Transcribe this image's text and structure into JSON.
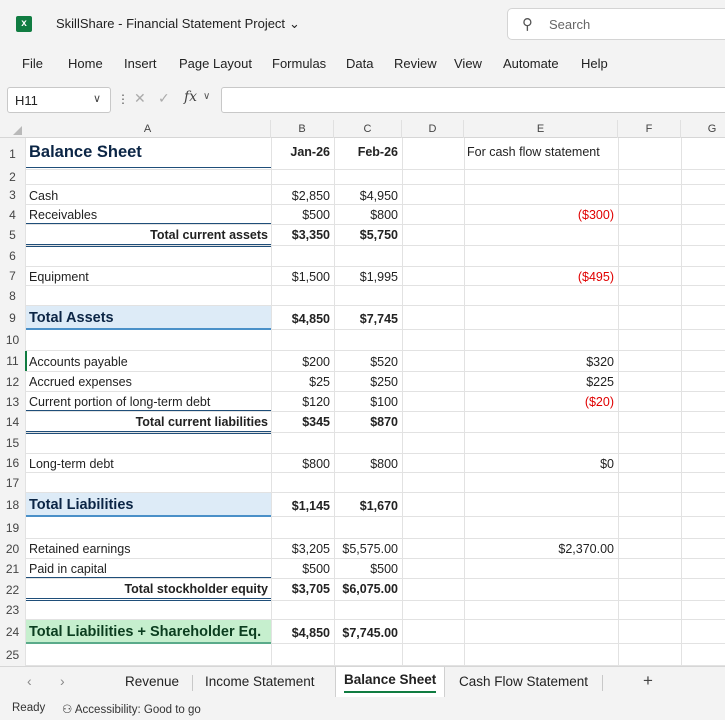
{
  "titlebar": {
    "doc_title": "SkillShare - Financial Statement Project",
    "search_placeholder": "Search"
  },
  "menu": [
    "File",
    "Home",
    "Insert",
    "Page Layout",
    "Formulas",
    "Data",
    "Review",
    "View",
    "Automate",
    "Help"
  ],
  "formula_bar": {
    "name_box": "H11",
    "fx_label": "fx",
    "formula": ""
  },
  "columns": [
    "A",
    "B",
    "C",
    "D",
    "E",
    "F",
    "G"
  ],
  "rows": {
    "r1": {
      "num": "1",
      "a": "Balance Sheet",
      "b": "Jan-26",
      "c": "Feb-26",
      "e": "For cash flow statement"
    },
    "r2": {
      "num": "2"
    },
    "r3": {
      "num": "3",
      "a": "Cash",
      "b": "$2,850",
      "c": "$4,950"
    },
    "r4": {
      "num": "4",
      "a": "Receivables",
      "b": "$500",
      "c": "$800",
      "e": "($300)"
    },
    "r5": {
      "num": "5",
      "a": "Total current assets",
      "b": "$3,350",
      "c": "$5,750"
    },
    "r6": {
      "num": "6"
    },
    "r7": {
      "num": "7",
      "a": "Equipment",
      "b": "$1,500",
      "c": "$1,995",
      "e": "($495)"
    },
    "r8": {
      "num": "8"
    },
    "r9": {
      "num": "9",
      "a": "Total Assets",
      "b": "$4,850",
      "c": "$7,745"
    },
    "r10": {
      "num": "10"
    },
    "r11": {
      "num": "11",
      "a": "Accounts payable",
      "b": "$200",
      "c": "$520",
      "e": "$320"
    },
    "r12": {
      "num": "12",
      "a": "Accrued expenses",
      "b": "$25",
      "c": "$250",
      "e": "$225"
    },
    "r13": {
      "num": "13",
      "a": "Current portion of long-term debt",
      "b": "$120",
      "c": "$100",
      "e": "($20)"
    },
    "r14": {
      "num": "14",
      "a": "Total current liabilities",
      "b": "$345",
      "c": "$870"
    },
    "r15": {
      "num": "15"
    },
    "r16": {
      "num": "16",
      "a": "Long-term debt",
      "b": "$800",
      "c": "$800",
      "e": "$0"
    },
    "r17": {
      "num": "17"
    },
    "r18": {
      "num": "18",
      "a": "Total Liabilities",
      "b": "$1,145",
      "c": "$1,670"
    },
    "r19": {
      "num": "19"
    },
    "r20": {
      "num": "20",
      "a": "Retained earnings",
      "b": "$3,205",
      "c": "$5,575.00",
      "e": "$2,370.00"
    },
    "r21": {
      "num": "21",
      "a": "Paid in capital",
      "b": "$500",
      "c": "$500"
    },
    "r22": {
      "num": "22",
      "a": "Total stockholder equity",
      "b": "$3,705",
      "c": "$6,075.00"
    },
    "r23": {
      "num": "23"
    },
    "r24": {
      "num": "24",
      "a": "Total Liabilities + Shareholder Eq.",
      "b": "$4,850",
      "c": "$7,745.00"
    },
    "r25": {
      "num": "25"
    }
  },
  "sheet_tabs": [
    "Revenue",
    "Income Statement",
    "Balance Sheet",
    "Cash Flow Statement"
  ],
  "active_sheet": "Balance Sheet",
  "status": {
    "ready": "Ready",
    "accessibility": "Accessibility: Good to go"
  },
  "colors": {
    "excel_green": "#107c41",
    "negative": "#e00000",
    "total_fill_blue": "#ddebf7",
    "total_fill_green": "#c6efce"
  }
}
